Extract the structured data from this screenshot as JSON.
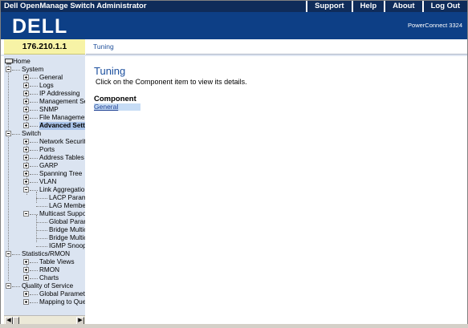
{
  "app": {
    "title": "Dell OpenManage Switch Administrator",
    "menu": [
      {
        "label": "Support"
      },
      {
        "label": "Help"
      },
      {
        "label": "About"
      },
      {
        "label": "Log Out"
      }
    ],
    "logo_text": "DELL",
    "model": "PowerConnect 3324",
    "ip": "176.210.1.1",
    "breadcrumb": "Tuning"
  },
  "colors": {
    "menu_bar": "#0f2c5a",
    "banner": "#0d3f86",
    "ip_box": "#f7f3a6",
    "tree_bg": "#dbe4f1",
    "accent": "#1b4f9e"
  },
  "tree": {
    "home": "Home",
    "system": "System",
    "system_items": [
      "General",
      "Logs",
      "IP Addressing",
      "Management Se",
      "SNMP",
      "File Managemer",
      "Advanced Sett"
    ],
    "switch": "Switch",
    "switch_items": [
      "Network Securit",
      "Ports",
      "Address Tables",
      "GARP",
      "Spanning Tree",
      "VLAN",
      "Link Aggregatior"
    ],
    "link_agg_children": [
      "LACP Param",
      "LAG Membe"
    ],
    "multicast": "Multicast Suppo",
    "multicast_children": [
      "Global Paran",
      "Bridge Multic",
      "Bridge Multic",
      "IGMP Snoop"
    ],
    "stats": "Statistics/RMON",
    "stats_items": [
      "Table Views",
      "RMON",
      "Charts"
    ],
    "qos": "Quality of Service",
    "qos_items": [
      "Global Paramete",
      "Mapping to Que"
    ]
  },
  "content": {
    "title": "Tuning",
    "description": "Click on the Component item to view its details.",
    "table_header": "Component",
    "rows": [
      "General"
    ]
  }
}
